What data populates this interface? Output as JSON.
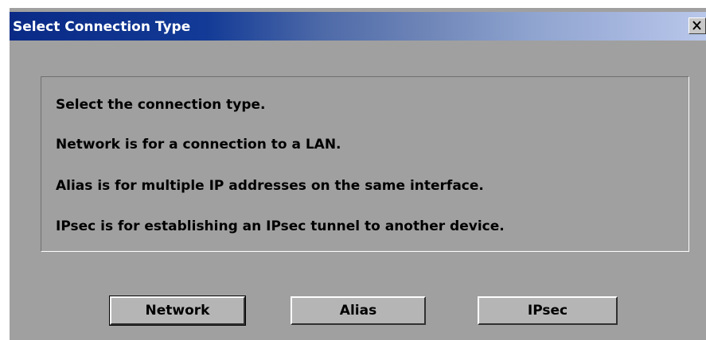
{
  "window": {
    "title": "Select Connection Type",
    "close_label": "X"
  },
  "info": {
    "lines": [
      "Select the connection type.",
      "Network is for a connection to a LAN.",
      "Alias is for multiple IP addresses on the same interface.",
      "IPsec is for establishing an IPsec tunnel to another device."
    ]
  },
  "buttons": {
    "network_label": "Network",
    "alias_label": "Alias",
    "ipsec_label": "IPsec"
  },
  "colors": {
    "title_bar_start": "#0a2a86",
    "title_bar_end": "#b9c8ea",
    "dialog_face": "#a0a0a0",
    "button_face": "#b5b5b5"
  }
}
